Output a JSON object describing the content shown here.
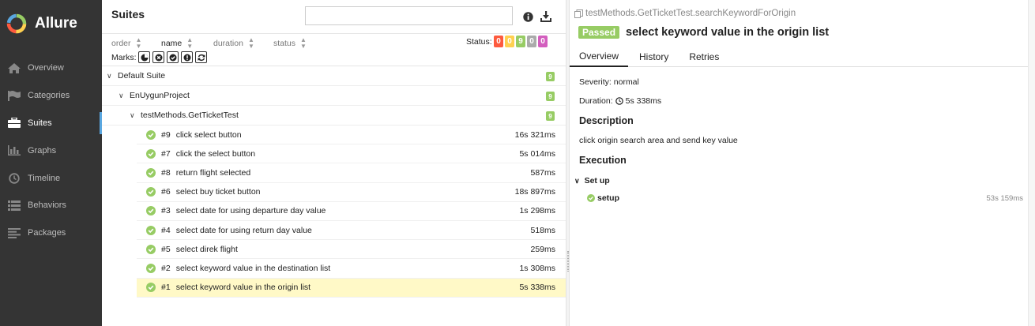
{
  "sidebar": {
    "brand": "Allure",
    "items": [
      {
        "label": "Overview",
        "icon": "home-icon"
      },
      {
        "label": "Categories",
        "icon": "flag-icon"
      },
      {
        "label": "Suites",
        "icon": "briefcase-icon",
        "active": true
      },
      {
        "label": "Graphs",
        "icon": "bar-chart-icon"
      },
      {
        "label": "Timeline",
        "icon": "clock-icon"
      },
      {
        "label": "Behaviors",
        "icon": "list-icon"
      },
      {
        "label": "Packages",
        "icon": "align-left-icon"
      }
    ]
  },
  "suites": {
    "title": "Suites",
    "search_value": "",
    "sort": {
      "order": "order",
      "name": "name",
      "duration": "duration",
      "status": "status"
    },
    "status_label": "Status:",
    "status_counts": [
      {
        "value": "0",
        "color": "#fd5a3e"
      },
      {
        "value": "0",
        "color": "#ffd050"
      },
      {
        "value": "9",
        "color": "#97cc64"
      },
      {
        "value": "0",
        "color": "#aaaaaa"
      },
      {
        "value": "0",
        "color": "#d35ebe"
      }
    ],
    "marks_label": "Marks:",
    "tree": {
      "root": {
        "label": "Default Suite",
        "count": "9"
      },
      "project": {
        "label": "EnUygunProject",
        "count": "9"
      },
      "class": {
        "label": "testMethods.GetTicketTest",
        "count": "9"
      },
      "tests": [
        {
          "num": "#9",
          "name": "click select button",
          "duration": "16s 321ms"
        },
        {
          "num": "#7",
          "name": "click the select button",
          "duration": "5s 014ms"
        },
        {
          "num": "#8",
          "name": "return flight selected",
          "duration": "587ms"
        },
        {
          "num": "#6",
          "name": "select buy ticket button",
          "duration": "18s 897ms"
        },
        {
          "num": "#3",
          "name": "select date for using departure day value",
          "duration": "1s 298ms"
        },
        {
          "num": "#4",
          "name": "select date for using return day value",
          "duration": "518ms"
        },
        {
          "num": "#5",
          "name": "select direk flight",
          "duration": "259ms"
        },
        {
          "num": "#2",
          "name": "select keyword value in the destination list",
          "duration": "1s 308ms"
        },
        {
          "num": "#1",
          "name": "select keyword value in the origin list",
          "duration": "5s 338ms",
          "selected": true
        }
      ]
    }
  },
  "detail": {
    "breadcrumb": "testMethods.GetTicketTest.searchKeywordForOrigin",
    "status": "Passed",
    "title": "select keyword value in the origin list",
    "tabs": [
      "Overview",
      "History",
      "Retries"
    ],
    "severity": "Severity: normal",
    "duration_label": "Duration:",
    "duration_value": "5s 338ms",
    "description_title": "Description",
    "description": "click origin search area and send key value",
    "execution_title": "Execution",
    "setup_title": "Set up",
    "step": {
      "name": "setup",
      "duration": "53s 159ms"
    }
  }
}
